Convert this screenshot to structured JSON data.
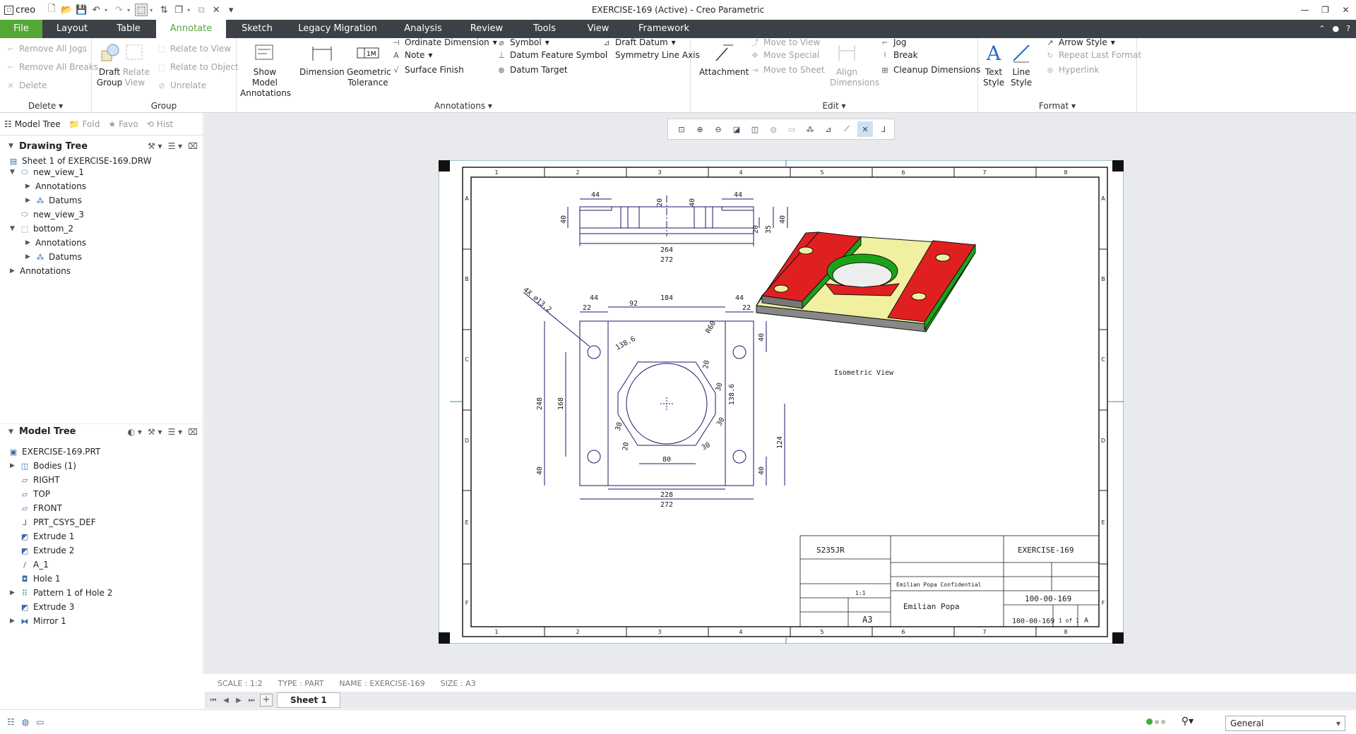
{
  "app": {
    "brand": "creo",
    "window_title": "EXERCISE-169 (Active) - Creo Parametric"
  },
  "tabs": [
    "File",
    "Layout",
    "Table",
    "Annotate",
    "Sketch",
    "Legacy Migration",
    "Analysis",
    "Review",
    "Tools",
    "View",
    "Framework"
  ],
  "active_tab": "Annotate",
  "ribbon": {
    "delete": {
      "remove_all_jogs": "Remove All Jogs",
      "remove_all_breaks": "Remove All Breaks",
      "delete": "Delete",
      "label": "Delete"
    },
    "group": {
      "draft_group": "Draft Group",
      "relate_view": "Relate View",
      "relate_to_view": "Relate to View",
      "relate_to_object": "Relate to Object",
      "unrelate": "Unrelate",
      "label": "Group"
    },
    "annotations": {
      "show_model": "Show Model Annotations",
      "dimension": "Dimension",
      "geometric_tolerance": "Geometric Tolerance",
      "ordinate_dimension": "Ordinate Dimension",
      "note": "Note",
      "surface_finish": "Surface Finish",
      "symbol": "Symbol",
      "datum_feature_symbol": "Datum Feature Symbol",
      "datum_target": "Datum Target",
      "draft_datum": "Draft Datum",
      "symmetry_line_axis": "Symmetry Line Axis",
      "label": "Annotations"
    },
    "edit": {
      "attachment": "Attachment",
      "move_to_view": "Move to View",
      "move_special": "Move Special",
      "move_to_sheet": "Move to Sheet",
      "align_dimensions": "Align Dimensions",
      "jog": "Jog",
      "break": "Break",
      "cleanup_dimensions": "Cleanup Dimensions",
      "label": "Edit"
    },
    "format": {
      "text_style": "Text Style",
      "line_style": "Line Style",
      "arrow_style": "Arrow Style",
      "repeat_last_format": "Repeat Last Format",
      "hyperlink": "Hyperlink",
      "label": "Format"
    }
  },
  "panel_tabs": [
    "Model Tree",
    "Fold",
    "Favo",
    "Hist"
  ],
  "drawing_tree": {
    "title": "Drawing Tree",
    "items": [
      "Sheet 1 of EXERCISE-169.DRW",
      "new_view_1",
      "Annotations",
      "Datums",
      "new_view_3",
      "bottom_2",
      "Annotations",
      "Datums",
      "Annotations"
    ]
  },
  "model_tree": {
    "title": "Model Tree",
    "items": [
      "EXERCISE-169.PRT",
      "Bodies (1)",
      "RIGHT",
      "TOP",
      "FRONT",
      "PRT_CSYS_DEF",
      "Extrude 1",
      "Extrude 2",
      "A_1",
      "Hole 1",
      "Pattern 1 of Hole 2",
      "Extrude 3",
      "Mirror 1"
    ]
  },
  "status": {
    "scale": "SCALE : 1:2",
    "type": "TYPE : PART",
    "name": "NAME : EXERCISE-169",
    "size": "SIZE : A3"
  },
  "sheet_tab": "Sheet 1",
  "filter_value": "General",
  "drawing": {
    "zone_numbers": [
      "1",
      "2",
      "3",
      "4",
      "5",
      "6",
      "7",
      "8"
    ],
    "zone_letters": [
      "A",
      "B",
      "C",
      "D",
      "E",
      "F"
    ],
    "dims_top": [
      "44",
      "20",
      "40",
      "44",
      "40",
      "20",
      "35",
      "40",
      "264",
      "272"
    ],
    "dims_front": [
      "4X ⌀13.2",
      "44",
      "22",
      "92",
      "184",
      "44",
      "22",
      "138.6",
      "R60",
      "40",
      "20",
      "30",
      "138.6",
      "248",
      "168",
      "30",
      "30",
      "30",
      "20",
      "124",
      "80",
      "40",
      "40",
      "228",
      "272"
    ],
    "iso_label": "Isometric View",
    "title_block": {
      "material": "S235JR",
      "description": "EXERCISE-169",
      "confidential": "Emilian Popa Confidential",
      "author": "Emilian Popa",
      "drawing_no": "100-00-169",
      "drawing_no2": "100-00-169",
      "sheet_size": "A3",
      "scale": "1:1",
      "sheet": "1 of 1",
      "revision": "A"
    }
  },
  "colors": {
    "accent": "#52a834",
    "tabbar": "#3c4147",
    "line": "#1a1a6e",
    "frame": "#3a8c9c",
    "green_face": "#1aa31a",
    "red_face": "#e02020",
    "yellow_face": "#f0f0a0"
  }
}
